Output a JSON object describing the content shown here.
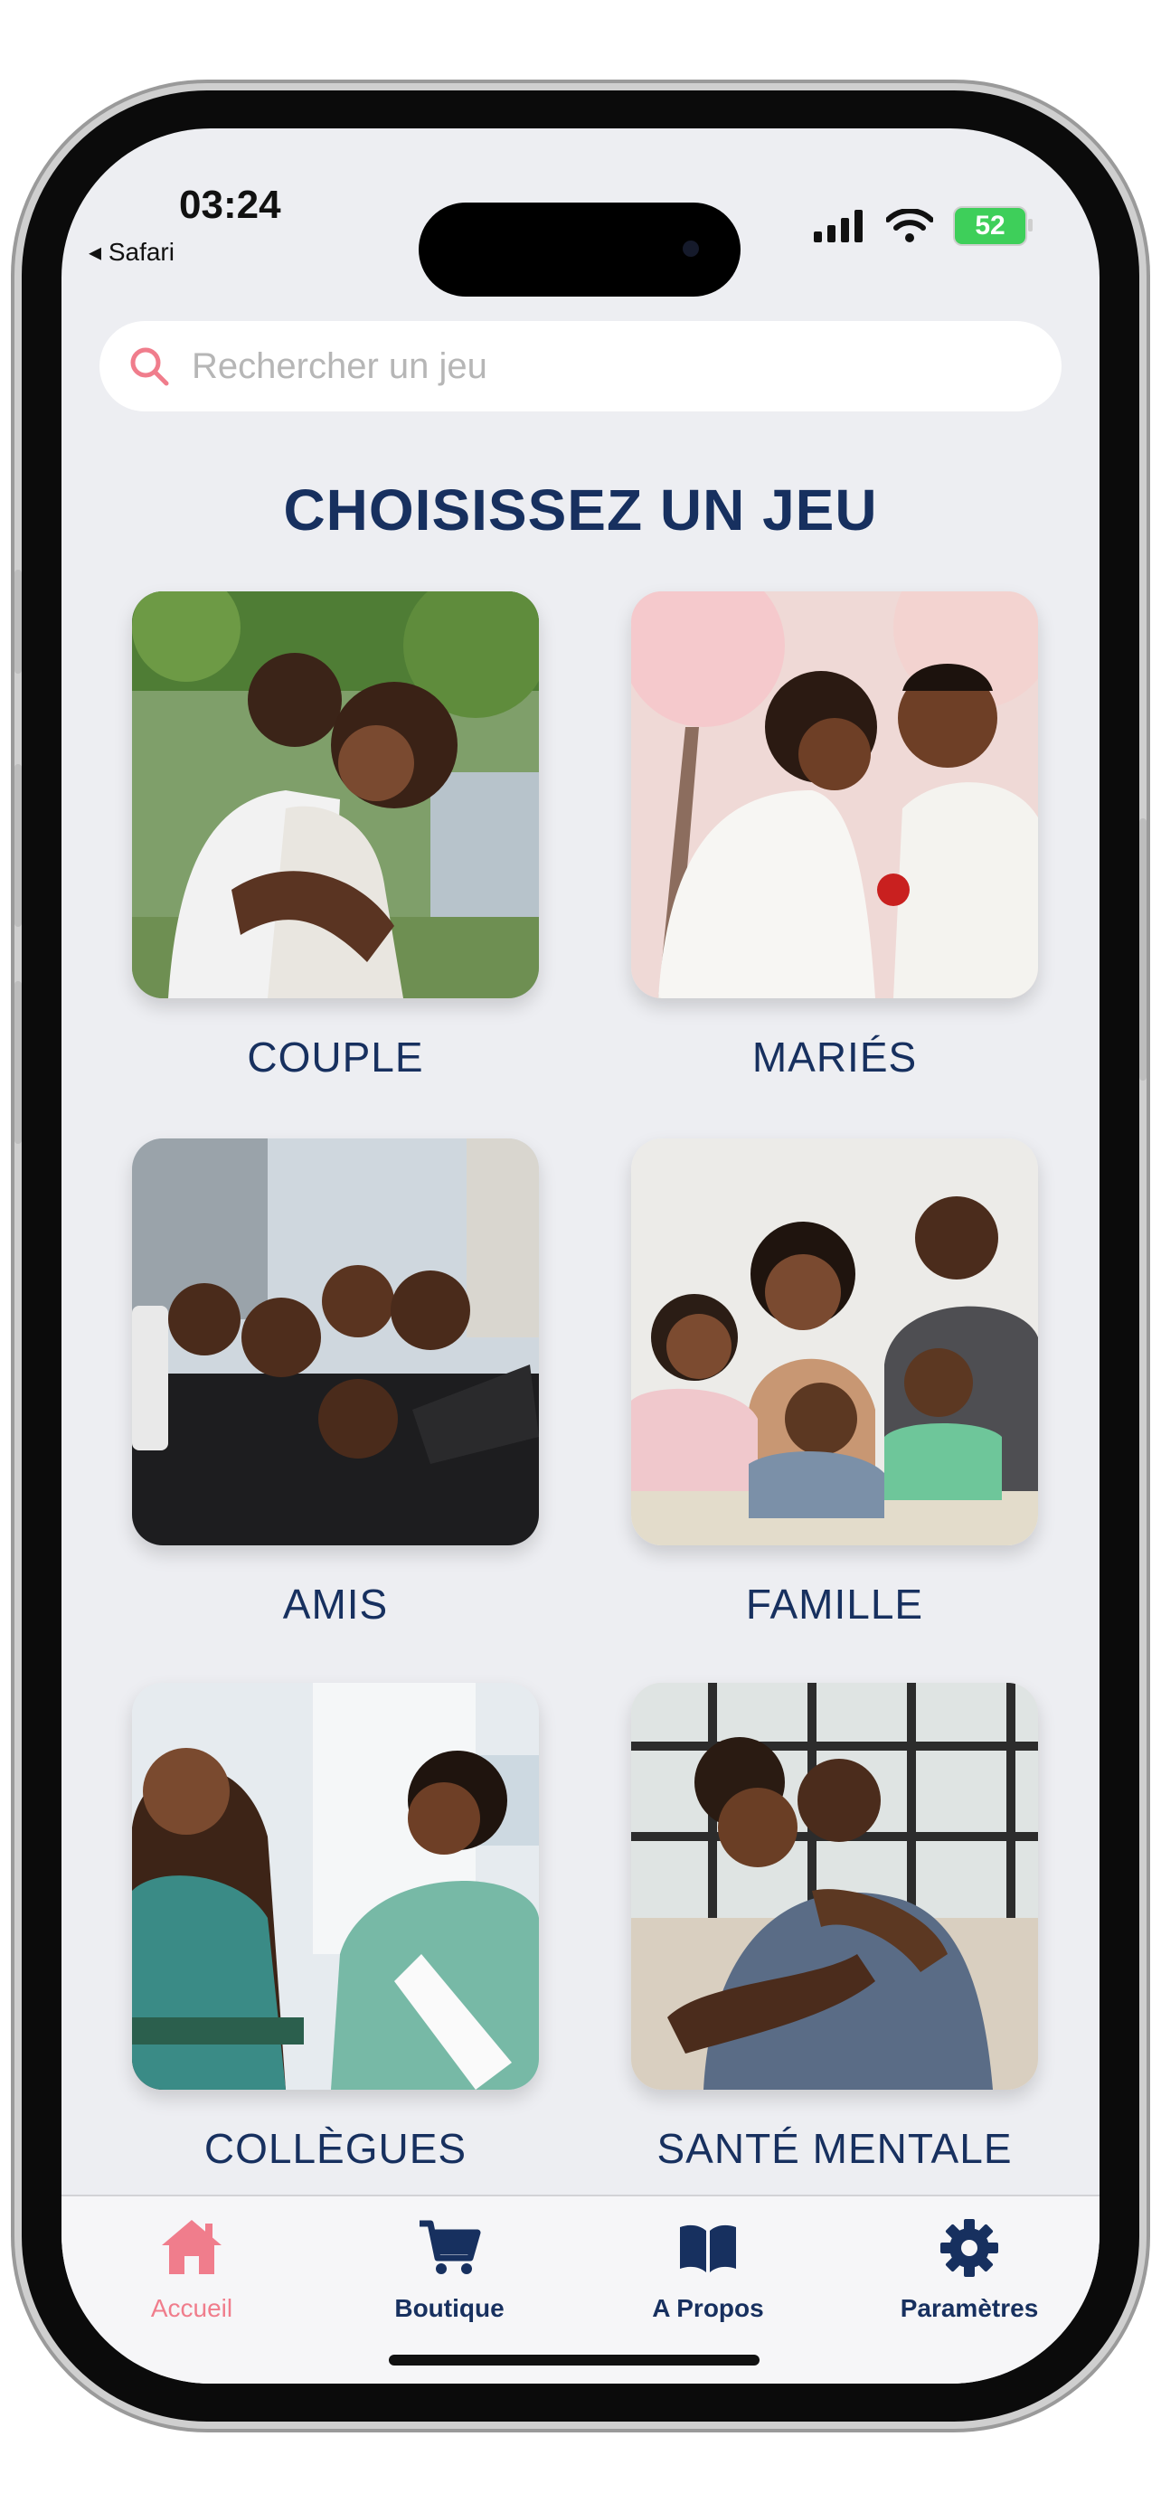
{
  "status": {
    "time": "03:24",
    "back_label": "◂ Safari",
    "battery": "52"
  },
  "search": {
    "placeholder": "Rechercher un jeu"
  },
  "page_title": "CHOISISSEZ UN JEU",
  "games": [
    {
      "label": "COUPLE"
    },
    {
      "label": "MARIÉS"
    },
    {
      "label": "AMIS"
    },
    {
      "label": "FAMILLE"
    },
    {
      "label": "COLLÈGUES"
    },
    {
      "label": "SANTÉ MENTALE"
    }
  ],
  "tabbar": {
    "items": [
      {
        "label": "Accueil",
        "icon": "home-icon"
      },
      {
        "label": "Boutique",
        "icon": "cart-icon"
      },
      {
        "label": "A Propos",
        "icon": "book-icon"
      },
      {
        "label": "Paramètres",
        "icon": "gear-icon"
      }
    ],
    "active": "Accueil"
  },
  "colors": {
    "accent": "#f07d8c",
    "title": "#17305f",
    "background": "#edeef2"
  }
}
